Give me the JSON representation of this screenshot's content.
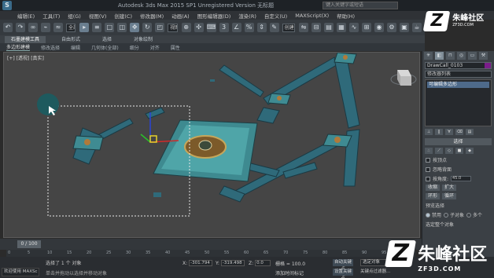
{
  "title_bar": {
    "title": "Autodesk 3ds Max 2015 SP1    Unregistered Version    无标题",
    "search_placeholder": "键入关键字或短语"
  },
  "menu": [
    "编辑(E)",
    "工具(T)",
    "组(G)",
    "视图(V)",
    "创建(C)",
    "修改器(M)",
    "动画(A)",
    "图形编辑器(D)",
    "渲染(R)",
    "自定义(U)",
    "MAXScript(X)",
    "帮助(H)"
  ],
  "toolbar": {
    "selection_filter": "全部",
    "reference_coord": "视图",
    "named_selection": "创建选择集"
  },
  "ribbon": {
    "tabs": [
      {
        "label": "石墨建模工具",
        "active": true
      },
      {
        "label": "自由形式",
        "active": false
      },
      {
        "label": "选择",
        "active": false
      },
      {
        "label": "对象绘制",
        "active": false
      }
    ],
    "sub_tabs": [
      {
        "label": "多边形建模",
        "active": true
      },
      {
        "label": "修改选择",
        "active": false
      },
      {
        "label": "编辑",
        "active": false
      },
      {
        "label": "几何体(全部)",
        "active": false
      },
      {
        "label": "细分",
        "active": false
      },
      {
        "label": "对齐",
        "active": false
      },
      {
        "label": "属性",
        "active": false
      }
    ]
  },
  "viewport": {
    "label": "[+] [透视] [真实]",
    "background": "#454545"
  },
  "command_panel": {
    "object_name": "DrawCall_0103",
    "object_color": "#7a1d8a",
    "modifier_list": "修改器列表",
    "stack_item": "可编辑多边形",
    "rollout_title": "选择",
    "checkbox_by_vertex": "按顶点",
    "checkbox_ignore_backface": "忽略背面",
    "checkbox_by_angle": "按角度:",
    "angle_value": "45.0",
    "btn_shrink": "收缩",
    "btn_grow": "扩大",
    "btn_ring": "环形",
    "btn_loop": "循环",
    "preview_label": "预览选择",
    "radio_off": "禁用",
    "radio_subobj": "子对象",
    "radio_multi": "多个",
    "selected_status": "选定整个对象"
  },
  "timeline": {
    "slider_label": "0 / 100",
    "ticks": [
      "0",
      "5",
      "10",
      "15",
      "20",
      "25",
      "30",
      "35",
      "40",
      "45",
      "50",
      "55",
      "60",
      "65",
      "70",
      "75",
      "80",
      "85",
      "90",
      "95",
      "100"
    ]
  },
  "status_bar": {
    "maxscript": "欢迎使用  MAXSc",
    "selection_status": "选择了 1 个 对象",
    "prompt": "单击并拖动以选择并移动对象",
    "x_label": "X:",
    "x_value": "-301.794",
    "y_label": "Y:",
    "y_value": "-319.498",
    "z_label": "Z:",
    "z_value": "0.0",
    "grid_label": "栅格 = 100.0",
    "add_time_tag": "添加时间标记",
    "auto_key": "自动关键点",
    "selected_set": "选定对象",
    "set_key": "设置关键点",
    "key_filters": "关键点过滤器..."
  },
  "watermark": {
    "logo_glyph": "Z",
    "name": "朱峰社区",
    "url": "ZF3D.COM",
    "url_small": "ZF3D.COM"
  }
}
